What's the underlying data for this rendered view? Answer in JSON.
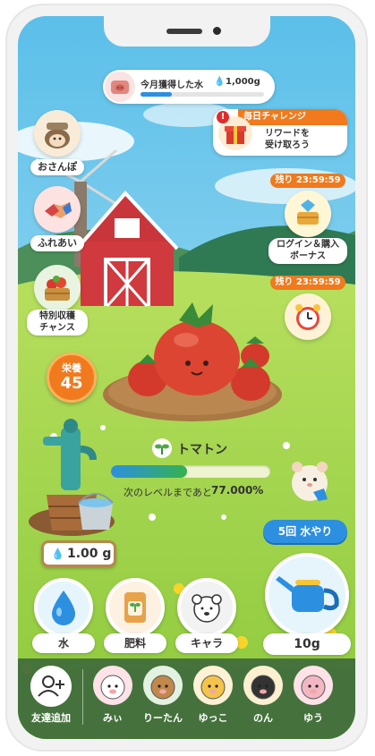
{
  "monthly": {
    "label": "今月獲得した水",
    "value": "1,000g",
    "progress": 0.25
  },
  "left_menu": {
    "walk": "おさんぽ",
    "touch": "ふれあい",
    "harvest": "特別収穫\nチャンス"
  },
  "right_menu": {
    "daily_badge": "毎日チャレンジ",
    "daily_text": "リワードを\n受け取ろう",
    "timer1": "残り 23:59:59",
    "login_bonus": "ログイン＆購入\nボーナス",
    "timer2": "残り 23:59:59"
  },
  "nutrition": {
    "label": "栄養",
    "value": "45"
  },
  "plant": {
    "name": "トマトン",
    "level_progress": 0.48,
    "next_level_label": "次のレベルまであと",
    "next_level_value": "77.000%"
  },
  "water_amount": "1.00 g",
  "water_button": "5回 水やり",
  "actions": {
    "water": "水",
    "fertilizer": "肥料",
    "chara": "キャラ",
    "watering_amount": "10g"
  },
  "friends": {
    "add_label": "友達追加",
    "list": [
      {
        "name": "みぃ",
        "icon": "cow-icon"
      },
      {
        "name": "りーたん",
        "icon": "monkey-icon"
      },
      {
        "name": "ゆっこ",
        "icon": "giraffe-icon"
      },
      {
        "name": "のん",
        "icon": "cat-icon"
      },
      {
        "name": "ゆう",
        "icon": "rabbit-icon"
      }
    ]
  },
  "colors": {
    "accent_orange": "#f07a1d",
    "accent_blue": "#2d8fe0",
    "progress_green": "#34b24f"
  }
}
